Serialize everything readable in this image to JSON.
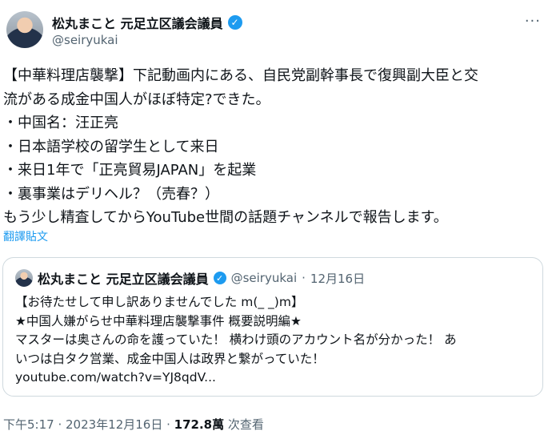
{
  "author": {
    "display_name": "松丸まこと 元足立区議会議員",
    "handle": "@seiryukai"
  },
  "icons": {
    "verified": "✓",
    "more": "···"
  },
  "tweet": {
    "lines": [
      "【中華料理店襲撃】下記動画内にある、自民党副幹事長で復興副大臣と交",
      "流がある成金中国人がほぼ特定?できた。",
      "・中国名：汪正亮",
      "・日本語学校の留学生として来日",
      "・来日1年で「正亮貿易JAPAN」を起業",
      "・裏事業はデリヘル？（売春？）",
      "もう少し精査してからYouTube世間の話題チャンネルで報告します。"
    ],
    "translate_label": "翻譯貼文"
  },
  "quote": {
    "display_name": "松丸まこと 元足立区議会議員",
    "handle": "@seiryukai",
    "separator": "·",
    "date": "12月16日",
    "lines": [
      "【お待たせして申し訳ありませんでした m(_ _)m】",
      "★中国人嫌がらせ中華料理店襲撃事件 概要説明編★",
      "マスターは奥さんの命を護っていた！ 横わけ頭のアカウント名が分かった！ あ",
      "いつは白タク営業、成金中国人は政界と繋がっていた！",
      "youtube.com/watch?v=YJ8qdV..."
    ]
  },
  "meta": {
    "time": "下午5:17",
    "separator": " · ",
    "date": "2023年12月16日",
    "views": "172.8萬",
    "views_label": " 次查看"
  }
}
